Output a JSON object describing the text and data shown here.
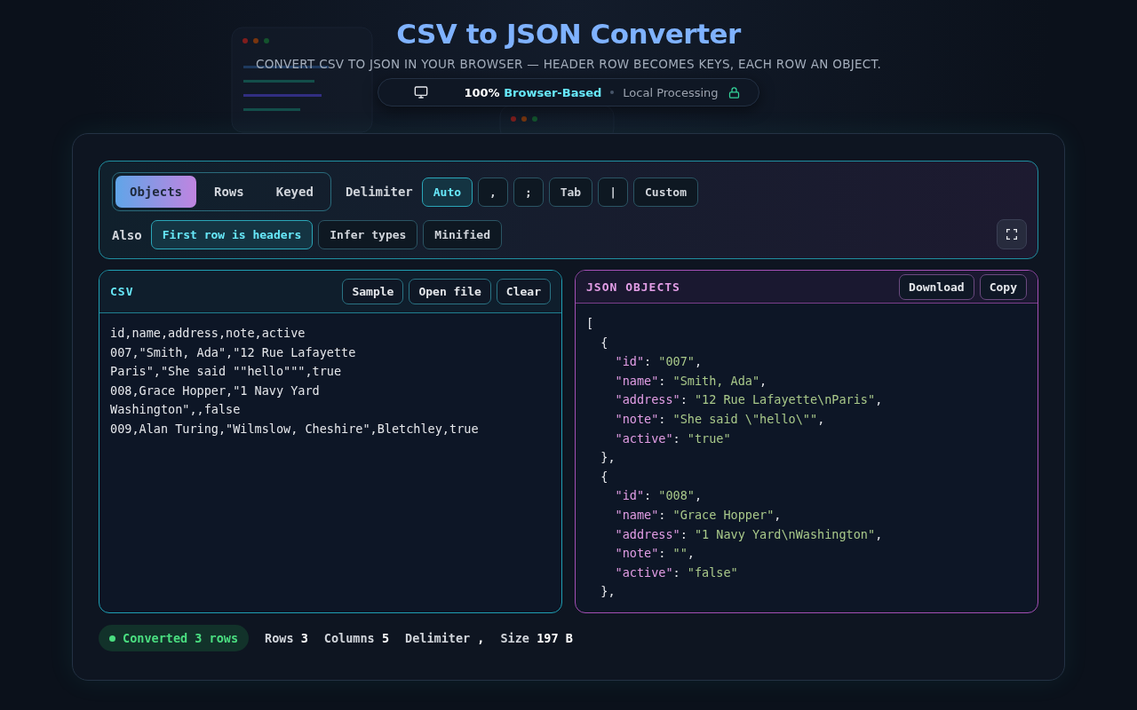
{
  "header": {
    "title": "CSV to JSON Converter",
    "subtitle": "CONVERT CSV TO JSON IN YOUR BROWSER — HEADER ROW BECOMES KEYS, EACH ROW AN OBJECT.",
    "badge": {
      "primary_prefix": "100%",
      "primary": "Browser-Based",
      "secondary": "Local Processing"
    }
  },
  "modes": [
    {
      "label": "Objects",
      "selected": true
    },
    {
      "label": "Rows",
      "selected": false
    },
    {
      "label": "Keyed",
      "selected": false
    }
  ],
  "delimiter": {
    "label": "Delimiter",
    "options": [
      {
        "label": "Auto",
        "selected": true
      },
      {
        "label": ",",
        "selected": false
      },
      {
        "label": ";",
        "selected": false
      },
      {
        "label": "Tab",
        "selected": false
      },
      {
        "label": "|",
        "selected": false
      },
      {
        "label": "Custom",
        "selected": false
      }
    ]
  },
  "also": {
    "label": "Also",
    "options": [
      {
        "label": "First row is headers",
        "on": true
      },
      {
        "label": "Infer types",
        "on": false
      },
      {
        "label": "Minified",
        "on": false
      }
    ]
  },
  "input_panel": {
    "title": "CSV",
    "buttons": [
      "Sample",
      "Open file",
      "Clear"
    ],
    "lines": [
      "id,name,address,note,active",
      "007,\"Smith, Ada\",\"12 Rue Lafayette",
      "Paris\",\"She said \"\"hello\"\"\",true",
      "008,Grace Hopper,\"1 Navy Yard",
      "Washington\",,false",
      "009,Alan Turing,\"Wilmslow, Cheshire\",Bletchley,true"
    ]
  },
  "output_panel": {
    "title": "JSON OBJECTS",
    "buttons": [
      "Download",
      "Copy"
    ],
    "lines": [
      "[",
      "  {",
      "    \"id\": \"007\",",
      "    \"name\": \"Smith, Ada\",",
      "    \"address\": \"12 Rue Lafayette\\nParis\",",
      "    \"note\": \"She said \\\"hello\\\"\",",
      "    \"active\": \"true\"",
      "  },",
      "  {",
      "    \"id\": \"008\",",
      "    \"name\": \"Grace Hopper\",",
      "    \"address\": \"1 Navy Yard\\nWashington\",",
      "    \"note\": \"\",",
      "    \"active\": \"false\"",
      "  },"
    ]
  },
  "status": {
    "message": "Converted 3 rows",
    "stats": [
      {
        "label": "Rows",
        "value": "3"
      },
      {
        "label": "Columns",
        "value": "5"
      },
      {
        "label": "Delimiter",
        "value": ","
      },
      {
        "label": "Size",
        "value": "197 B"
      }
    ]
  }
}
